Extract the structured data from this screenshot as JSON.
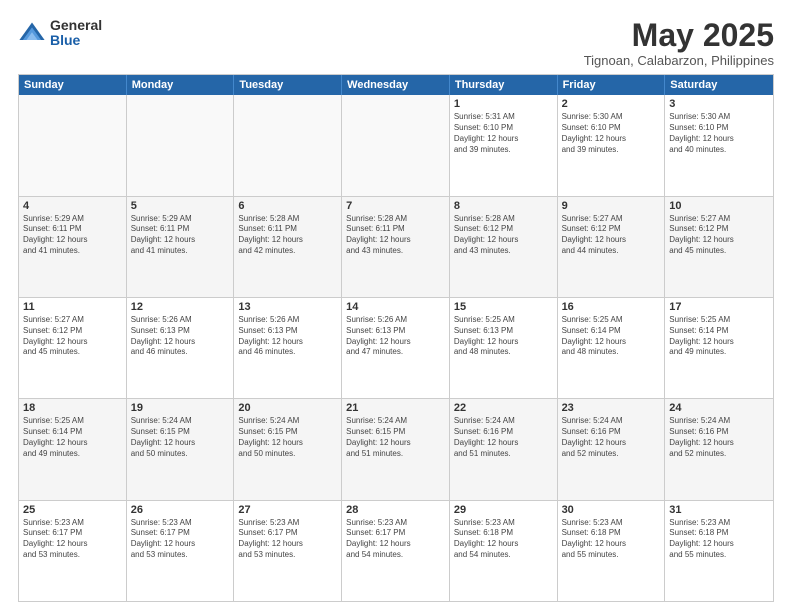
{
  "logo": {
    "general": "General",
    "blue": "Blue"
  },
  "title": "May 2025",
  "subtitle": "Tignoan, Calabarzon, Philippines",
  "days": [
    "Sunday",
    "Monday",
    "Tuesday",
    "Wednesday",
    "Thursday",
    "Friday",
    "Saturday"
  ],
  "weeks": [
    [
      {
        "day": "",
        "info": ""
      },
      {
        "day": "",
        "info": ""
      },
      {
        "day": "",
        "info": ""
      },
      {
        "day": "",
        "info": ""
      },
      {
        "day": "1",
        "info": "Sunrise: 5:31 AM\nSunset: 6:10 PM\nDaylight: 12 hours\nand 39 minutes."
      },
      {
        "day": "2",
        "info": "Sunrise: 5:30 AM\nSunset: 6:10 PM\nDaylight: 12 hours\nand 39 minutes."
      },
      {
        "day": "3",
        "info": "Sunrise: 5:30 AM\nSunset: 6:10 PM\nDaylight: 12 hours\nand 40 minutes."
      }
    ],
    [
      {
        "day": "4",
        "info": "Sunrise: 5:29 AM\nSunset: 6:11 PM\nDaylight: 12 hours\nand 41 minutes."
      },
      {
        "day": "5",
        "info": "Sunrise: 5:29 AM\nSunset: 6:11 PM\nDaylight: 12 hours\nand 41 minutes."
      },
      {
        "day": "6",
        "info": "Sunrise: 5:28 AM\nSunset: 6:11 PM\nDaylight: 12 hours\nand 42 minutes."
      },
      {
        "day": "7",
        "info": "Sunrise: 5:28 AM\nSunset: 6:11 PM\nDaylight: 12 hours\nand 43 minutes."
      },
      {
        "day": "8",
        "info": "Sunrise: 5:28 AM\nSunset: 6:12 PM\nDaylight: 12 hours\nand 43 minutes."
      },
      {
        "day": "9",
        "info": "Sunrise: 5:27 AM\nSunset: 6:12 PM\nDaylight: 12 hours\nand 44 minutes."
      },
      {
        "day": "10",
        "info": "Sunrise: 5:27 AM\nSunset: 6:12 PM\nDaylight: 12 hours\nand 45 minutes."
      }
    ],
    [
      {
        "day": "11",
        "info": "Sunrise: 5:27 AM\nSunset: 6:12 PM\nDaylight: 12 hours\nand 45 minutes."
      },
      {
        "day": "12",
        "info": "Sunrise: 5:26 AM\nSunset: 6:13 PM\nDaylight: 12 hours\nand 46 minutes."
      },
      {
        "day": "13",
        "info": "Sunrise: 5:26 AM\nSunset: 6:13 PM\nDaylight: 12 hours\nand 46 minutes."
      },
      {
        "day": "14",
        "info": "Sunrise: 5:26 AM\nSunset: 6:13 PM\nDaylight: 12 hours\nand 47 minutes."
      },
      {
        "day": "15",
        "info": "Sunrise: 5:25 AM\nSunset: 6:13 PM\nDaylight: 12 hours\nand 48 minutes."
      },
      {
        "day": "16",
        "info": "Sunrise: 5:25 AM\nSunset: 6:14 PM\nDaylight: 12 hours\nand 48 minutes."
      },
      {
        "day": "17",
        "info": "Sunrise: 5:25 AM\nSunset: 6:14 PM\nDaylight: 12 hours\nand 49 minutes."
      }
    ],
    [
      {
        "day": "18",
        "info": "Sunrise: 5:25 AM\nSunset: 6:14 PM\nDaylight: 12 hours\nand 49 minutes."
      },
      {
        "day": "19",
        "info": "Sunrise: 5:24 AM\nSunset: 6:15 PM\nDaylight: 12 hours\nand 50 minutes."
      },
      {
        "day": "20",
        "info": "Sunrise: 5:24 AM\nSunset: 6:15 PM\nDaylight: 12 hours\nand 50 minutes."
      },
      {
        "day": "21",
        "info": "Sunrise: 5:24 AM\nSunset: 6:15 PM\nDaylight: 12 hours\nand 51 minutes."
      },
      {
        "day": "22",
        "info": "Sunrise: 5:24 AM\nSunset: 6:16 PM\nDaylight: 12 hours\nand 51 minutes."
      },
      {
        "day": "23",
        "info": "Sunrise: 5:24 AM\nSunset: 6:16 PM\nDaylight: 12 hours\nand 52 minutes."
      },
      {
        "day": "24",
        "info": "Sunrise: 5:24 AM\nSunset: 6:16 PM\nDaylight: 12 hours\nand 52 minutes."
      }
    ],
    [
      {
        "day": "25",
        "info": "Sunrise: 5:23 AM\nSunset: 6:17 PM\nDaylight: 12 hours\nand 53 minutes."
      },
      {
        "day": "26",
        "info": "Sunrise: 5:23 AM\nSunset: 6:17 PM\nDaylight: 12 hours\nand 53 minutes."
      },
      {
        "day": "27",
        "info": "Sunrise: 5:23 AM\nSunset: 6:17 PM\nDaylight: 12 hours\nand 53 minutes."
      },
      {
        "day": "28",
        "info": "Sunrise: 5:23 AM\nSunset: 6:17 PM\nDaylight: 12 hours\nand 54 minutes."
      },
      {
        "day": "29",
        "info": "Sunrise: 5:23 AM\nSunset: 6:18 PM\nDaylight: 12 hours\nand 54 minutes."
      },
      {
        "day": "30",
        "info": "Sunrise: 5:23 AM\nSunset: 6:18 PM\nDaylight: 12 hours\nand 55 minutes."
      },
      {
        "day": "31",
        "info": "Sunrise: 5:23 AM\nSunset: 6:18 PM\nDaylight: 12 hours\nand 55 minutes."
      }
    ]
  ]
}
